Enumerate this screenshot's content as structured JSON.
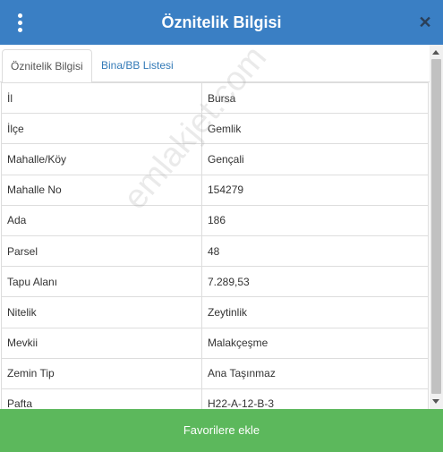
{
  "header": {
    "title": "Öznitelik Bilgisi",
    "menu_icon": "vertical-dots-icon",
    "close_icon": "close-x-icon",
    "background_color": "#3a7fc4"
  },
  "tabs": [
    {
      "label": "Öznitelik Bilgisi",
      "active": true
    },
    {
      "label": "Bina/BB Listesi",
      "active": false
    }
  ],
  "attributes": [
    {
      "key": "İl",
      "value": "Bursa"
    },
    {
      "key": "İlçe",
      "value": "Gemlik"
    },
    {
      "key": "Mahalle/Köy",
      "value": "Gençali"
    },
    {
      "key": "Mahalle No",
      "value": "154279"
    },
    {
      "key": "Ada",
      "value": "186"
    },
    {
      "key": "Parsel",
      "value": "48"
    },
    {
      "key": "Tapu Alanı",
      "value": "7.289,53"
    },
    {
      "key": "Nitelik",
      "value": "Zeytinlik"
    },
    {
      "key": "Mevkii",
      "value": "Malakçeşme"
    },
    {
      "key": "Zemin Tip",
      "value": "Ana Taşınmaz"
    },
    {
      "key": "Pafta",
      "value": "H22-A-12-B-3"
    }
  ],
  "watermark": "emlakjet.com",
  "footer": {
    "button_label": "Favorilere ekle",
    "color": "#5cb85c"
  }
}
